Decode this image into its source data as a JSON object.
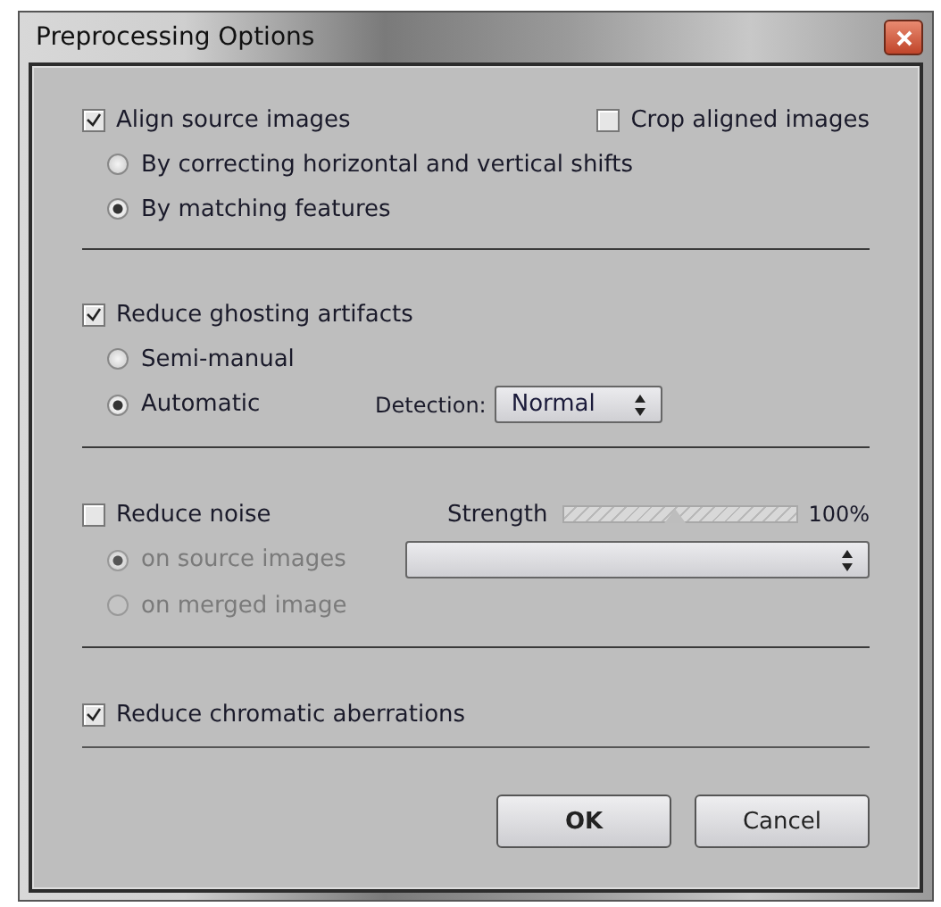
{
  "window": {
    "title": "Preprocessing Options"
  },
  "align": {
    "label": "Align source images",
    "checked": true,
    "crop": {
      "label": "Crop aligned images",
      "checked": false
    },
    "options": [
      {
        "label": "By correcting horizontal and vertical shifts",
        "selected": false,
        "disabled": false
      },
      {
        "label": "By matching features",
        "selected": true,
        "disabled": false
      }
    ]
  },
  "ghosting": {
    "label": "Reduce ghosting artifacts",
    "checked": true,
    "options": [
      {
        "label": "Semi-manual",
        "selected": false,
        "disabled": false
      },
      {
        "label": "Automatic",
        "selected": true,
        "disabled": false
      }
    ],
    "detection": {
      "label": "Detection:",
      "value": "Normal"
    }
  },
  "noise": {
    "label": "Reduce noise",
    "checked": false,
    "strength": {
      "label": "Strength",
      "level": 0.48,
      "reading": "100%"
    },
    "options": [
      {
        "label": "on source images",
        "selected": true,
        "disabled": true
      },
      {
        "label": "on merged image",
        "selected": false,
        "disabled": true
      }
    ]
  },
  "chromatic": {
    "label": "Reduce chromatic aberrations",
    "checked": true
  },
  "buttons": [
    {
      "label": "OK",
      "default": true
    },
    {
      "label": "Cancel",
      "default": false
    }
  ]
}
